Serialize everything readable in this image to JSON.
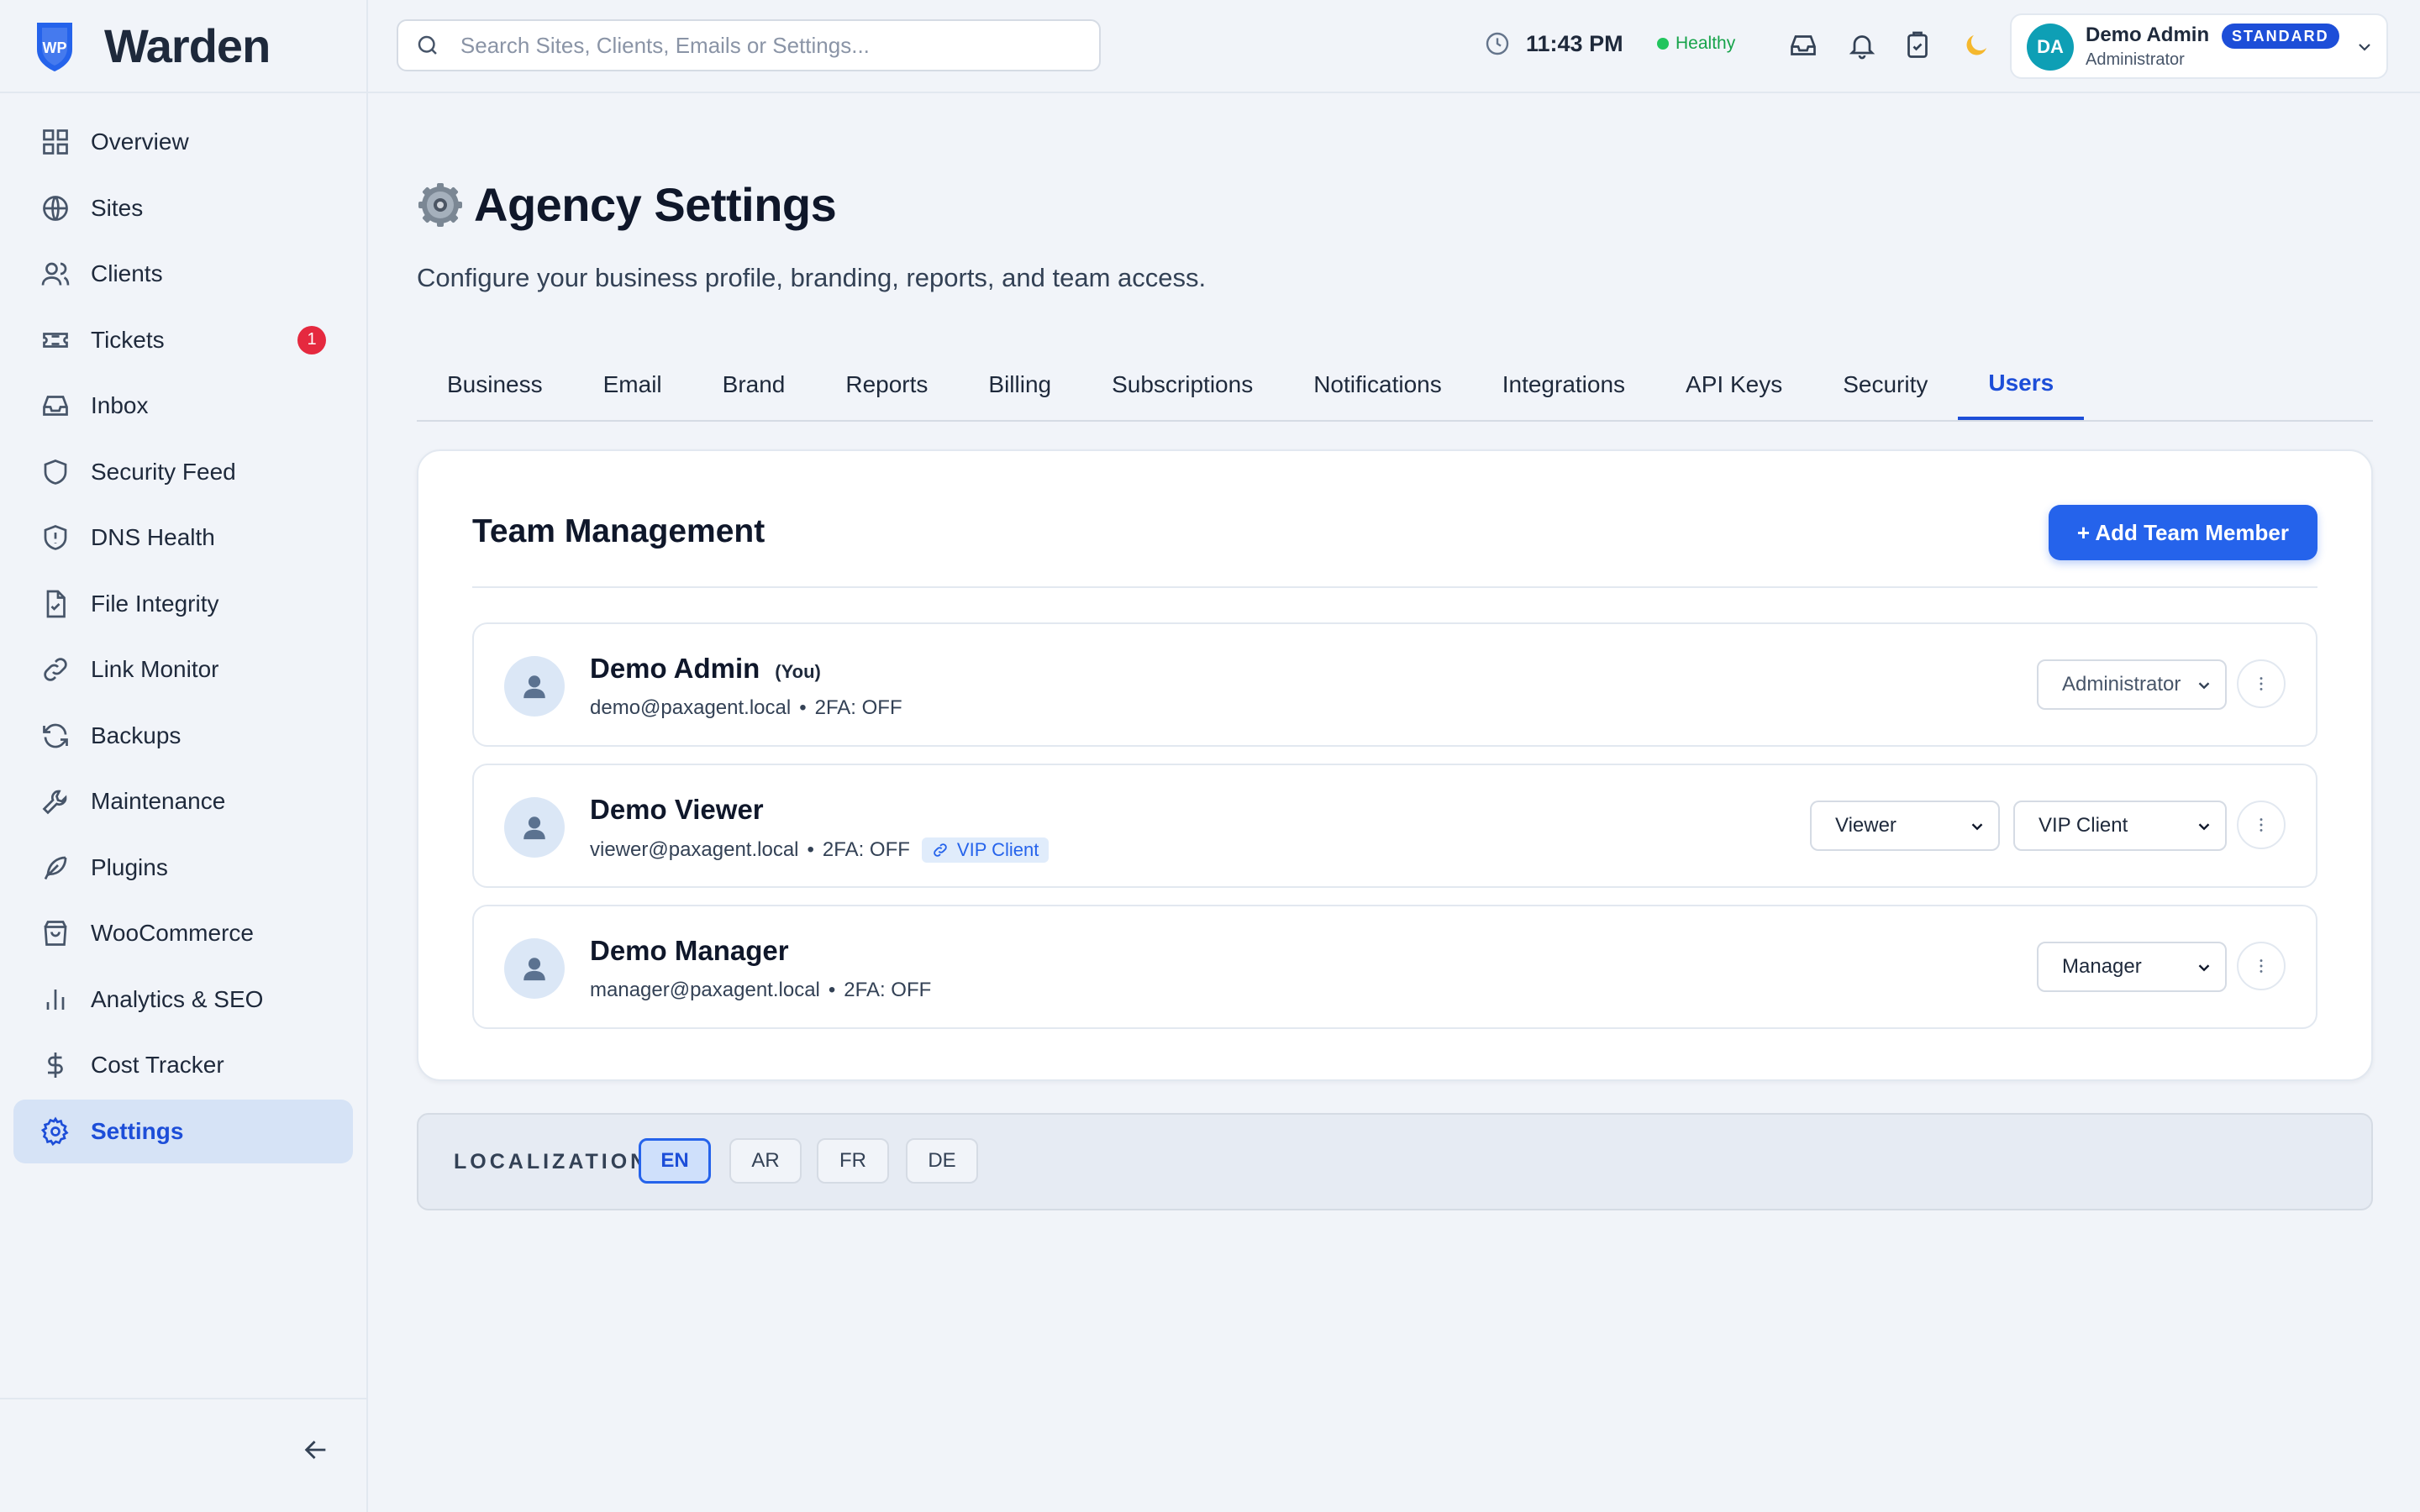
{
  "app": {
    "name": "Warden",
    "logo_text": "WP"
  },
  "sidebar": {
    "items": [
      {
        "label": "Overview",
        "icon": "grid-icon"
      },
      {
        "label": "Sites",
        "icon": "globe-icon"
      },
      {
        "label": "Clients",
        "icon": "users-icon"
      },
      {
        "label": "Tickets",
        "icon": "ticket-icon",
        "badge": "1"
      },
      {
        "label": "Inbox",
        "icon": "inbox-icon"
      },
      {
        "label": "Security Feed",
        "icon": "shield-icon"
      },
      {
        "label": "DNS Health",
        "icon": "shield-alert-icon"
      },
      {
        "label": "File Integrity",
        "icon": "file-check-icon"
      },
      {
        "label": "Link Monitor",
        "icon": "link-icon"
      },
      {
        "label": "Backups",
        "icon": "refresh-icon"
      },
      {
        "label": "Maintenance",
        "icon": "wrench-icon"
      },
      {
        "label": "Plugins",
        "icon": "feather-icon"
      },
      {
        "label": "WooCommerce",
        "icon": "shopping-bag-icon"
      },
      {
        "label": "Analytics & SEO",
        "icon": "bar-chart-icon"
      },
      {
        "label": "Cost Tracker",
        "icon": "dollar-icon"
      },
      {
        "label": "Settings",
        "icon": "gear-icon",
        "active": true
      }
    ]
  },
  "topbar": {
    "search_placeholder": "Search Sites, Clients, Emails or Settings...",
    "time": "11:43 PM",
    "health": "Healthy",
    "user": {
      "initials": "DA",
      "name": "Demo Admin",
      "role": "Administrator",
      "plan": "STANDARD"
    }
  },
  "page": {
    "title": "Agency Settings",
    "subtitle": "Configure your business profile, branding, reports, and team access.",
    "tabs": [
      "Business",
      "Email",
      "Brand",
      "Reports",
      "Billing",
      "Subscriptions",
      "Notifications",
      "Integrations",
      "API Keys",
      "Security",
      "Users"
    ],
    "active_tab": "Users"
  },
  "team": {
    "title": "Team Management",
    "add_button": "+ Add Team Member",
    "members": [
      {
        "name": "Demo Admin",
        "you": "(You)",
        "email": "demo@paxagent.local",
        "twofa": "2FA: OFF",
        "role": "Administrator"
      },
      {
        "name": "Demo Viewer",
        "email": "viewer@paxagent.local",
        "twofa": "2FA: OFF",
        "client_tag": "VIP Client",
        "role": "Viewer",
        "client": "VIP Client"
      },
      {
        "name": "Demo Manager",
        "email": "manager@paxagent.local",
        "twofa": "2FA: OFF",
        "role": "Manager"
      }
    ],
    "separator": "•"
  },
  "localization": {
    "label": "LOCALIZATION",
    "languages": [
      "EN",
      "AR",
      "FR",
      "DE"
    ],
    "active": "EN"
  },
  "colors": {
    "accent": "#2563eb",
    "badge": "#e5293f",
    "healthy": "#22c55e",
    "avatar": "#0e9fb5"
  }
}
